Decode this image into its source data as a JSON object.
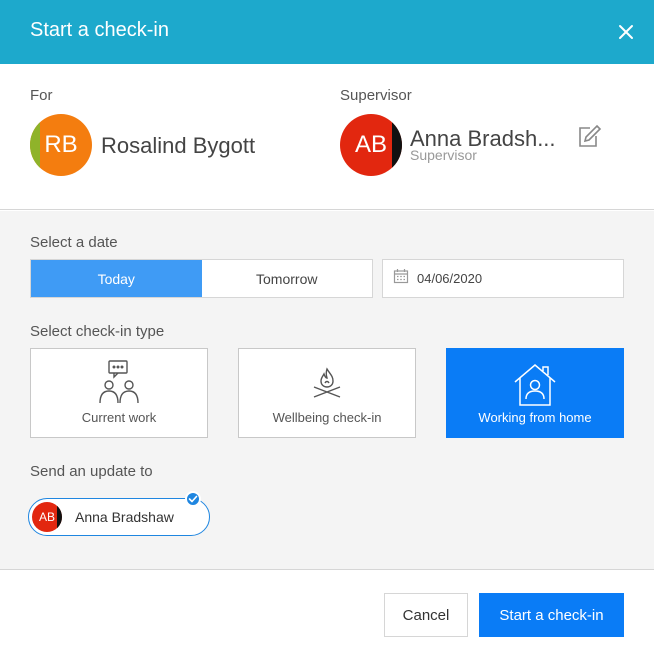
{
  "header": {
    "title": "Start a check-in",
    "close_icon": "close-icon"
  },
  "people": {
    "for_label": "For",
    "for_person": {
      "initials": "RB",
      "name": "Rosalind Bygott"
    },
    "supervisor_label": "Supervisor",
    "supervisor": {
      "initials": "AB",
      "name": "Anna Bradsh...",
      "role": "Supervisor"
    },
    "edit_icon": "edit-icon"
  },
  "date": {
    "label": "Select a date",
    "options": [
      "Today",
      "Tomorrow"
    ],
    "selected": "Today",
    "value": "04/06/2020",
    "icon": "calendar-icon"
  },
  "checkin_type": {
    "label": "Select check-in type",
    "options": [
      {
        "label": "Current work",
        "icon": "chat-people-icon"
      },
      {
        "label": "Wellbeing check-in",
        "icon": "campfire-icon"
      },
      {
        "label": "Working from home",
        "icon": "house-person-icon"
      }
    ],
    "selected": "Working from home"
  },
  "send_update": {
    "label": "Send an update to",
    "recipient": {
      "initials": "AB",
      "name": "Anna Bradshaw",
      "checked": true
    }
  },
  "footer": {
    "cancel_label": "Cancel",
    "submit_label": "Start a check-in"
  },
  "colors": {
    "header": "#1da9cc",
    "primary": "#0a7cf6",
    "toggle_active": "#3f9bf5",
    "section_bg": "#f4f4f4"
  }
}
